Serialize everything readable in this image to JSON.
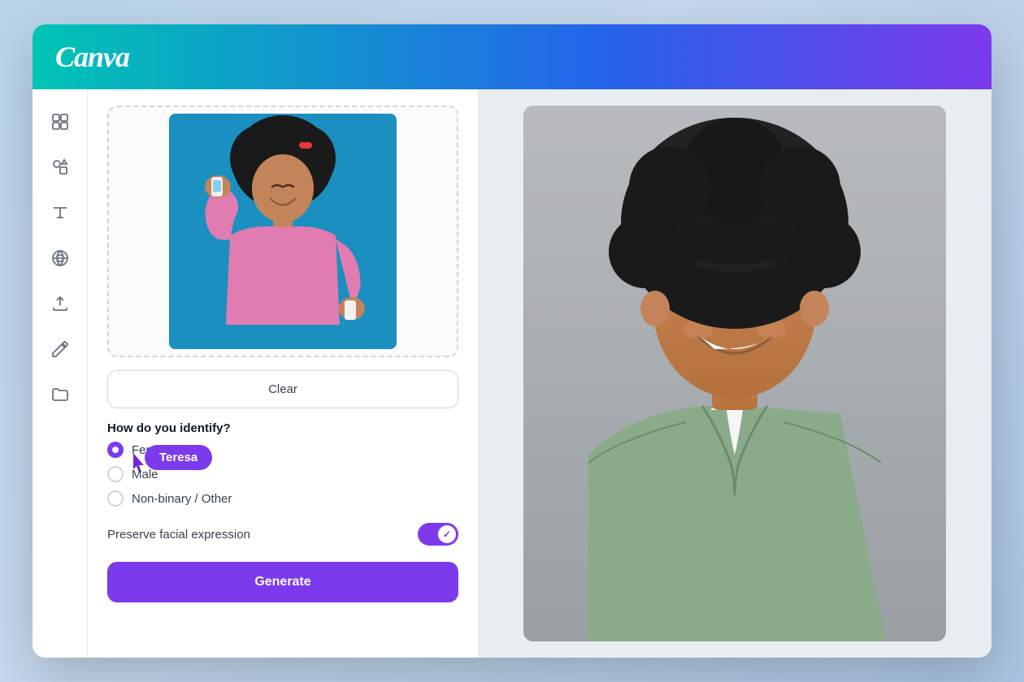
{
  "app": {
    "logo": "Canva",
    "window_bg": "#f0f4f8"
  },
  "header": {
    "gradient_start": "#00c4b4",
    "gradient_mid": "#2563eb",
    "gradient_end": "#7c3aed"
  },
  "sidebar": {
    "icons": [
      {
        "name": "layout-icon",
        "symbol": "⊞",
        "label": "Layout"
      },
      {
        "name": "elements-icon",
        "symbol": "◇",
        "label": "Elements"
      },
      {
        "name": "text-icon",
        "symbol": "T",
        "label": "Text"
      },
      {
        "name": "apps-icon",
        "symbol": "◎",
        "label": "Apps"
      },
      {
        "name": "upload-icon",
        "symbol": "↑",
        "label": "Upload"
      },
      {
        "name": "draw-icon",
        "symbol": "✏",
        "label": "Draw"
      },
      {
        "name": "projects-icon",
        "symbol": "📁",
        "label": "Projects"
      }
    ]
  },
  "panel": {
    "clear_button": "Clear",
    "section_question": "How do you identify?",
    "radio_options": [
      {
        "value": "female",
        "label": "Female",
        "selected": true
      },
      {
        "value": "male",
        "label": "Male",
        "selected": false
      },
      {
        "value": "nonbinary",
        "label": "Non-binary / Other",
        "selected": false
      }
    ],
    "tooltip_name": "Teresa",
    "preserve_label": "Preserve facial expression",
    "preserve_enabled": true,
    "generate_button": "Generate"
  }
}
